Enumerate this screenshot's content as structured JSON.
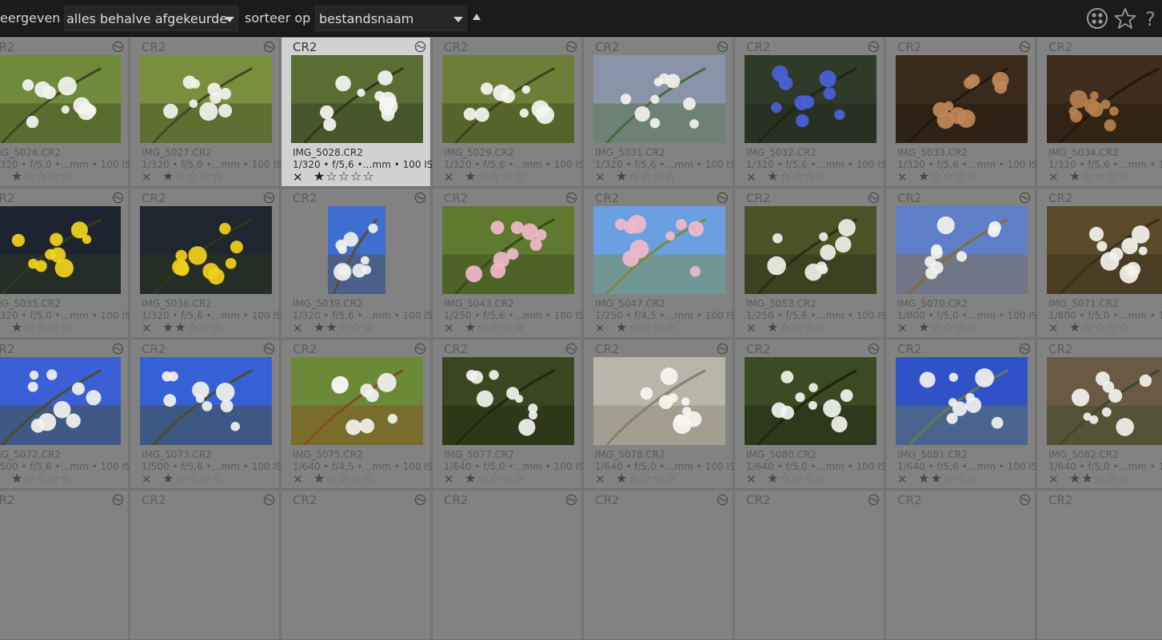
{
  "toolbar": {
    "show_label": "eergeven",
    "filter_value": "alles behalve afgekeurde",
    "sort_label": "sorteer op",
    "sort_value": "bestandsnaam",
    "help_glyph": "?",
    "icons": [
      "grouping-icon",
      "star-overlay-icon",
      "help-icon"
    ]
  },
  "colors": {
    "toolbar_bg": "#1b1b1b",
    "grid_bg": "#7a7a7a",
    "cell_bg": "#828282",
    "selected_cell_bg": "#d1d1d1"
  },
  "thumbnails": [
    {
      "ext": "CR2",
      "file": "IMG_5026.CR2",
      "exif": "1/320 • f/5,0 •…mm • 100 ISO",
      "stars": 1,
      "orientation": "landscape",
      "palette": [
        "#6f8a3a",
        "#f4f4f0",
        "#3c4a22"
      ]
    },
    {
      "ext": "CR2",
      "file": "IMG_5027.CR2",
      "exif": "1/320 • f/5,0 •…mm • 100 ISO",
      "stars": 1,
      "orientation": "landscape",
      "palette": [
        "#7a8f3e",
        "#f3f3ee",
        "#3f4a24"
      ]
    },
    {
      "ext": "CR2",
      "file": "IMG_5028.CR2",
      "exif": "1/320 • f/5,6 •…mm • 100 ISO",
      "stars": 1,
      "orientation": "landscape",
      "palette": [
        "#5a6e34",
        "#f6f6f2",
        "#2e3a1e"
      ],
      "selected": true
    },
    {
      "ext": "CR2",
      "file": "IMG_5029.CR2",
      "exif": "1/320 • f/5,6 •…mm • 100 ISO",
      "stars": 1,
      "orientation": "landscape",
      "palette": [
        "#6d7e38",
        "#f5f5f0",
        "#3a4520"
      ]
    },
    {
      "ext": "CR2",
      "file": "IMG_5031.CR2",
      "exif": "1/320 • f/5,6 •…mm • 100 ISO",
      "stars": 1,
      "orientation": "landscape",
      "palette": [
        "#8a94a8",
        "#f2f2ee",
        "#4a6a3a"
      ]
    },
    {
      "ext": "CR2",
      "file": "IMG_5032.CR2",
      "exif": "1/320 • f/5,6 •…mm • 100 ISO",
      "stars": 1,
      "orientation": "landscape",
      "palette": [
        "#2f3a28",
        "#4a62d8",
        "#1e2618"
      ]
    },
    {
      "ext": "CR2",
      "file": "IMG_5033.CR2",
      "exif": "1/320 • f/5,6 •…mm • 100 ISO",
      "stars": 1,
      "orientation": "landscape",
      "palette": [
        "#3a2a1c",
        "#c08858",
        "#22180e"
      ]
    },
    {
      "ext": "CR2",
      "file": "IMG_5034.CR2",
      "exif": "1/320 • f/5,6 •…mm • 100 ISO",
      "stars": 1,
      "orientation": "landscape",
      "palette": [
        "#3e2c1c",
        "#b6804e",
        "#24180e"
      ]
    },
    {
      "ext": "CR2",
      "file": "IMG_5035.CR2",
      "exif": "1/320 • f/5,0 •…mm • 100 ISO",
      "stars": 1,
      "orientation": "landscape",
      "palette": [
        "#1d2430",
        "#f3d41c",
        "#2e3a1c"
      ]
    },
    {
      "ext": "CR2",
      "file": "IMG_5036.CR2",
      "exif": "1/320 • f/5,6 •…mm • 100 ISO",
      "stars": 2,
      "orientation": "landscape",
      "palette": [
        "#1f2630",
        "#f2d01a",
        "#2c381c"
      ]
    },
    {
      "ext": "CR2",
      "file": "IMG_5039.CR2",
      "exif": "1/320 • f/5,6 •…mm • 100 ISO",
      "stars": 2,
      "orientation": "portrait",
      "palette": [
        "#3d6ed0",
        "#f1f1ee",
        "#5a5030"
      ]
    },
    {
      "ext": "CR2",
      "file": "IMG_5043.CR2",
      "exif": "1/250 • f/5,6 •…mm • 100 ISO",
      "stars": 1,
      "orientation": "landscape",
      "palette": [
        "#5f7a2e",
        "#f1b8cc",
        "#3a4a1e"
      ]
    },
    {
      "ext": "CR2",
      "file": "IMG_5047.CR2",
      "exif": "1/250 • f/4,5 •…mm • 100 ISO",
      "stars": 1,
      "orientation": "landscape",
      "palette": [
        "#6aa0e2",
        "#f0b8c8",
        "#7a8a3a"
      ]
    },
    {
      "ext": "CR2",
      "file": "IMG_5053.CR2",
      "exif": "1/250 • f/5,6 •…mm • 100 ISO",
      "stars": 1,
      "orientation": "landscape",
      "palette": [
        "#4a5228",
        "#f0f0e8",
        "#2a2e18"
      ]
    },
    {
      "ext": "CR2",
      "file": "IMG_5070.CR2",
      "exif": "1/800 • f/5,0 •…mm • 100 ISO",
      "stars": 1,
      "orientation": "landscape",
      "palette": [
        "#5e7fc8",
        "#f3f3ef",
        "#8a6a3a"
      ]
    },
    {
      "ext": "CR2",
      "file": "IMG_5071.CR2",
      "exif": "1/800 • f/5,0 •…mm • 100 ISO",
      "stars": 1,
      "orientation": "landscape",
      "palette": [
        "#5a4a2a",
        "#f3f3ee",
        "#3a2e1a"
      ]
    },
    {
      "ext": "CR2",
      "file": "IMG_5072.CR2",
      "exif": "1/500 • f/5,6 •…mm • 100 ISO",
      "stars": 1,
      "orientation": "landscape",
      "palette": [
        "#3a5fd6",
        "#f3f3ee",
        "#4a5026"
      ]
    },
    {
      "ext": "CR2",
      "file": "IMG_5073.CR2",
      "exif": "1/500 • f/5,6 •…mm • 100 ISO",
      "stars": 1,
      "orientation": "landscape",
      "palette": [
        "#3660d6",
        "#f2f2ed",
        "#4a5026"
      ]
    },
    {
      "ext": "CR2",
      "file": "IMG_5075.CR2",
      "exif": "1/640 • f/4,5 •…mm • 100 ISO",
      "stars": 1,
      "orientation": "landscape",
      "palette": [
        "#6a8a38",
        "#f2f2ee",
        "#8a4a22"
      ]
    },
    {
      "ext": "CR2",
      "file": "IMG_5077.CR2",
      "exif": "1/640 • f/5,0 •…mm • 100 ISO",
      "stars": 1,
      "orientation": "landscape",
      "palette": [
        "#3a4620",
        "#f3f3ef",
        "#22280f"
      ]
    },
    {
      "ext": "CR2",
      "file": "IMG_5078.CR2",
      "exif": "1/640 • f/5,0 •…mm • 100 ISO",
      "stars": 1,
      "orientation": "landscape",
      "palette": [
        "#b8b6a8",
        "#f8f6f0",
        "#8a8070"
      ]
    },
    {
      "ext": "CR2",
      "file": "IMG_5080.CR2",
      "exif": "1/640 • f/5,0 •…mm • 100 ISO",
      "stars": 1,
      "orientation": "landscape",
      "palette": [
        "#3a4a22",
        "#f3f3ef",
        "#1e2612"
      ]
    },
    {
      "ext": "CR2",
      "file": "IMG_5081.CR2",
      "exif": "1/640 • f/5,6 •…mm • 100 ISO",
      "stars": 2,
      "orientation": "landscape",
      "palette": [
        "#2f52c8",
        "#f2f2ee",
        "#6a7a4a"
      ]
    },
    {
      "ext": "CR2",
      "file": "IMG_5082.CR2",
      "exif": "1/640 • f/5,0 •…mm • 100 ISO",
      "stars": 2,
      "orientation": "landscape",
      "palette": [
        "#6a5a44",
        "#f2f2ee",
        "#3a4a28"
      ]
    },
    {
      "ext": "CR2",
      "file": "",
      "exif": "",
      "stars": 0,
      "orientation": "none",
      "palette": [
        "#828282",
        "#828282",
        "#828282"
      ]
    },
    {
      "ext": "CR2",
      "file": "",
      "exif": "",
      "stars": 0,
      "orientation": "none",
      "palette": [
        "#828282",
        "#828282",
        "#828282"
      ]
    },
    {
      "ext": "CR2",
      "file": "",
      "exif": "",
      "stars": 0,
      "orientation": "none",
      "palette": [
        "#828282",
        "#828282",
        "#828282"
      ]
    },
    {
      "ext": "CR2",
      "file": "",
      "exif": "",
      "stars": 0,
      "orientation": "none",
      "palette": [
        "#828282",
        "#828282",
        "#828282"
      ]
    },
    {
      "ext": "CR2",
      "file": "",
      "exif": "",
      "stars": 0,
      "orientation": "none",
      "palette": [
        "#828282",
        "#828282",
        "#828282"
      ]
    },
    {
      "ext": "CR2",
      "file": "",
      "exif": "",
      "stars": 0,
      "orientation": "none",
      "palette": [
        "#828282",
        "#828282",
        "#828282"
      ]
    },
    {
      "ext": "CR2",
      "file": "",
      "exif": "",
      "stars": 0,
      "orientation": "none",
      "palette": [
        "#828282",
        "#828282",
        "#828282"
      ]
    },
    {
      "ext": "CR2",
      "file": "",
      "exif": "",
      "stars": 0,
      "orientation": "none",
      "palette": [
        "#828282",
        "#828282",
        "#828282"
      ]
    }
  ]
}
